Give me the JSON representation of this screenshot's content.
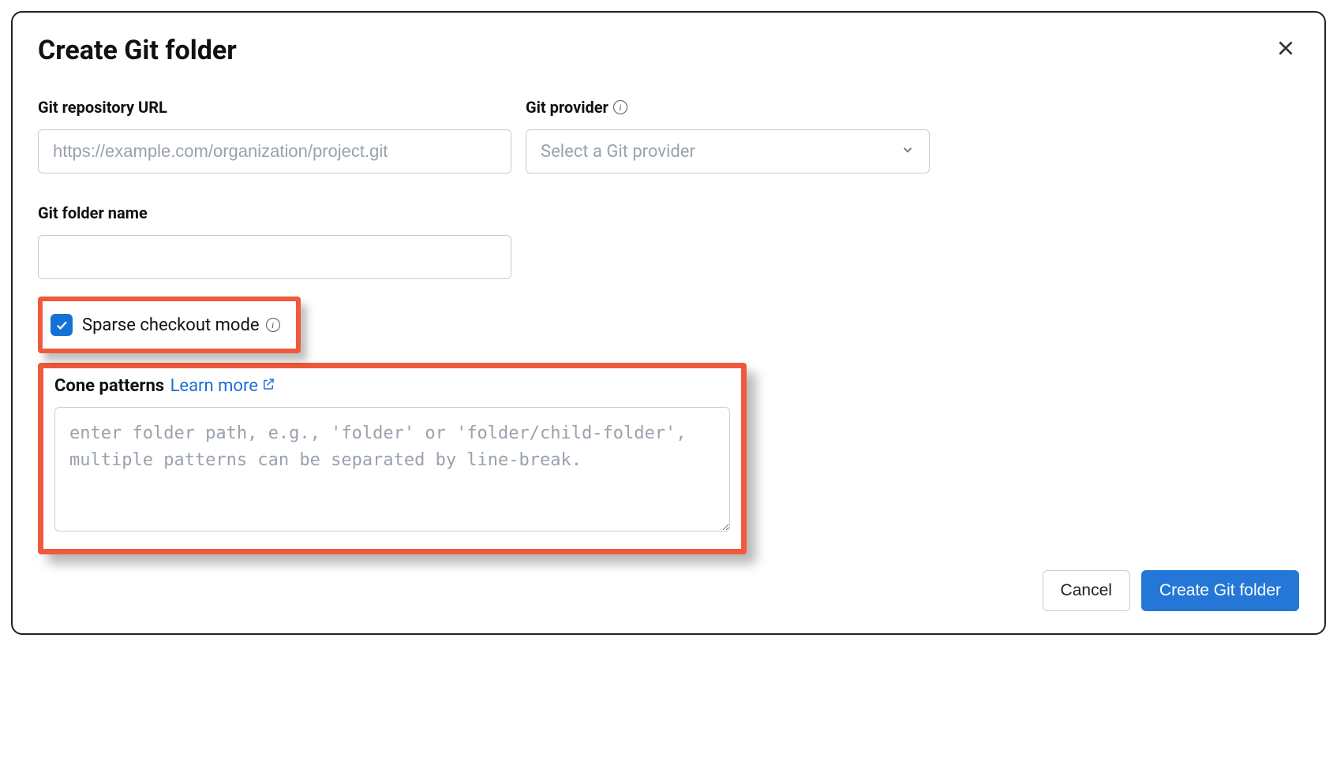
{
  "dialog": {
    "title": "Create Git folder"
  },
  "repoUrl": {
    "label": "Git repository URL",
    "placeholder": "https://example.com/organization/project.git",
    "value": ""
  },
  "provider": {
    "label": "Git provider",
    "placeholder": "Select a Git provider",
    "value": ""
  },
  "folderName": {
    "label": "Git folder name",
    "value": ""
  },
  "sparse": {
    "label": "Sparse checkout mode",
    "checked": true
  },
  "cone": {
    "label": "Cone patterns",
    "learnMore": "Learn more",
    "placeholder": "enter folder path, e.g., 'folder' or 'folder/child-folder', multiple patterns can be separated by line-break.",
    "value": ""
  },
  "buttons": {
    "cancel": "Cancel",
    "create": "Create Git folder"
  }
}
